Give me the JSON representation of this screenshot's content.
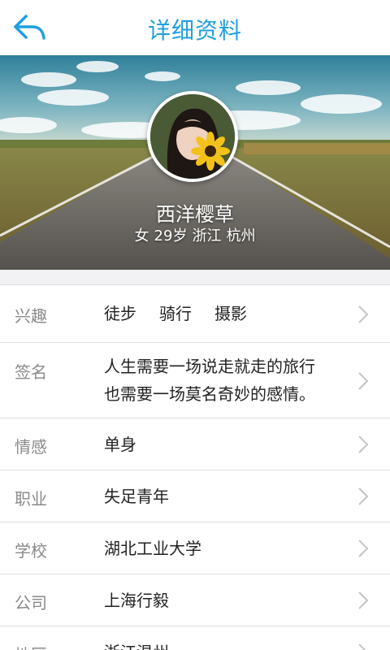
{
  "header": {
    "title": "详细资料",
    "back_icon": "back-arrow-icon"
  },
  "profile": {
    "name": "西洋樱草",
    "gender": "女",
    "age": "29岁",
    "province": "浙江",
    "city": "杭州"
  },
  "details": [
    {
      "key": "interests",
      "label": "兴趣",
      "tags": [
        "徒步",
        "骑行",
        "摄影"
      ]
    },
    {
      "key": "signature",
      "label": "签名",
      "lines": [
        "人生需要一场说走就走的旅行",
        "也需要一场莫名奇妙的感情。"
      ]
    },
    {
      "key": "relationship",
      "label": "情感",
      "value": "单身"
    },
    {
      "key": "occupation",
      "label": "职业",
      "value": "失足青年"
    },
    {
      "key": "school",
      "label": "学校",
      "value": "湖北工业大学"
    },
    {
      "key": "company",
      "label": "公司",
      "value": "上海行毅"
    },
    {
      "key": "region",
      "label": "地区",
      "value": "浙江温州"
    }
  ],
  "colors": {
    "accent": "#1f9fe0",
    "label": "#8a8a8a",
    "value": "#222222",
    "divider": "#dedede"
  }
}
